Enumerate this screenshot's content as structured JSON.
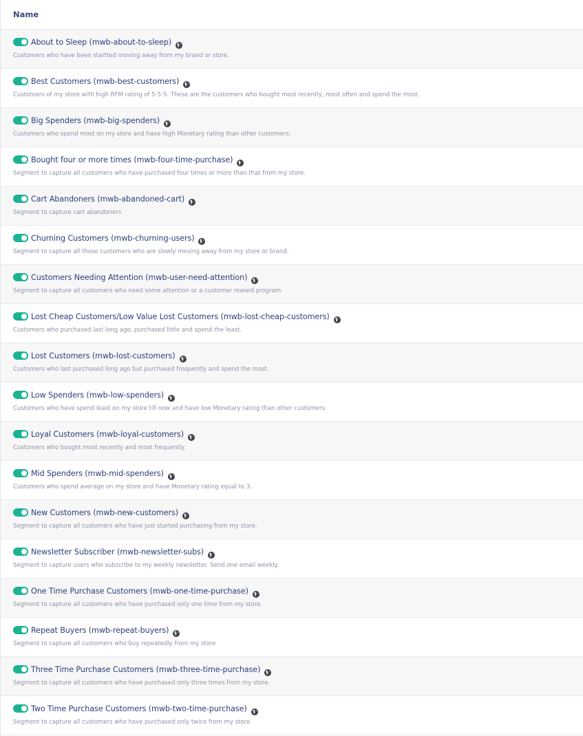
{
  "colors": {
    "toggle_on": "#1bb394",
    "link": "#2f3d7a",
    "description": "#8c93a3",
    "header": "#3a4a7a"
  },
  "table": {
    "header": {
      "name_label": "Name"
    },
    "rows": [
      {
        "name": "About to Sleep (mwb-about-to-sleep)",
        "description": "Customers who have been startted moving away from my brand or store.",
        "enabled": true,
        "icon": "globe-icon"
      },
      {
        "name": "Best Customers (mwb-best-customers)",
        "description": "Customers of my store with high RFM rating of 5-5-5. These are the customers who bought most recently, most often and spend the most.",
        "enabled": true,
        "icon": "globe-icon"
      },
      {
        "name": "Big Spenders (mwb-big-spenders)",
        "description": "Customers who spend most on my store and have high Monetary rating than other customers.",
        "enabled": true,
        "icon": "globe-icon"
      },
      {
        "name": "Bought four or more times (mwb-four-time-purchase)",
        "description": "Segment to capture all customers who have purchased four times or more than that from my store.",
        "enabled": true,
        "icon": "globe-icon"
      },
      {
        "name": "Cart Abandoners (mwb-abandoned-cart)",
        "description": "Segment to capture cart abandoners",
        "enabled": true,
        "icon": "globe-icon"
      },
      {
        "name": "Churning Customers (mwb-churning-users)",
        "description": "Segment to capture all those customers who are slowly moving away from my store or brand.",
        "enabled": true,
        "icon": "globe-icon"
      },
      {
        "name": "Customers Needing Attention (mwb-user-need-attention)",
        "description": "Segment to capture all customers who need some attention or a customer reward program",
        "enabled": true,
        "icon": "globe-icon"
      },
      {
        "name": "Lost Cheap Customers/Low Value Lost Customers (mwb-lost-cheap-customers)",
        "description": "Customers who purchased last long ago, purchased little and spend the least.",
        "enabled": true,
        "icon": "globe-icon"
      },
      {
        "name": "Lost Customers (mwb-lost-customers)",
        "description": "Customers who last purchased long ago but purchased frequently and spend the most.",
        "enabled": true,
        "icon": "globe-icon"
      },
      {
        "name": "Low Spenders (mwb-low-spenders)",
        "description": "Customers who have spend least on my store till now and have low Monetary rating than other customers.",
        "enabled": true,
        "icon": "globe-icon"
      },
      {
        "name": "Loyal Customers (mwb-loyal-customers)",
        "description": "Customers who bought most recently and most frequently.",
        "enabled": true,
        "icon": "globe-icon"
      },
      {
        "name": "Mid Spenders (mwb-mid-spenders)",
        "description": "Customers who spend average on my store and have Monetary rating equal to 3.",
        "enabled": true,
        "icon": "globe-icon"
      },
      {
        "name": "New Customers (mwb-new-customers)",
        "description": "Segment to capture all customers who have just started purchasing from my store.",
        "enabled": true,
        "icon": "globe-icon"
      },
      {
        "name": "Newsletter Subscriber (mwb-newsletter-subs)",
        "description": "Segment to capture users who subscribe to my weekly newsletter. Send one email weekly.",
        "enabled": true,
        "icon": "globe-icon"
      },
      {
        "name": "One Time Purchase Customers (mwb-one-time-purchase)",
        "description": "Segment to capture all customers who have purchased only one time from my store.",
        "enabled": true,
        "icon": "globe-icon"
      },
      {
        "name": "Repeat Buyers (mwb-repeat-buyers)",
        "description": "Segment to capture all customers who buy repeatedly from my store",
        "enabled": true,
        "icon": "globe-icon"
      },
      {
        "name": "Three Time Purchase Customers (mwb-three-time-purchase)",
        "description": "Segment to capture all customers who have purchased only three times from my store.",
        "enabled": true,
        "icon": "globe-icon"
      },
      {
        "name": "Two Time Purchase Customers (mwb-two-time-purchase)",
        "description": "Segment to capture all customers who have purchased only twice from my store.",
        "enabled": true,
        "icon": "globe-icon"
      }
    ]
  }
}
